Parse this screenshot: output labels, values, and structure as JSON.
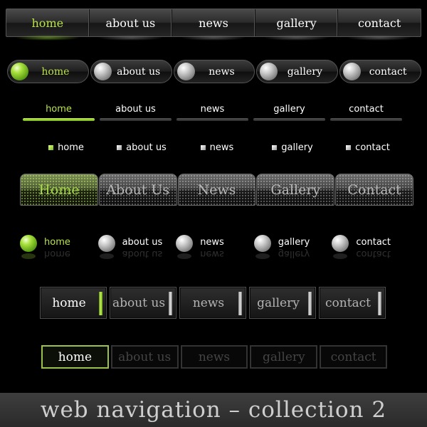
{
  "nav_labels": [
    "home",
    "about us",
    "news",
    "gallery",
    "contact"
  ],
  "nav_labels_capitalized": [
    "Home",
    "About Us",
    "News",
    "Gallery",
    "Contact"
  ],
  "active_item": "home",
  "colors": {
    "background": "#000000",
    "accent_green": "#b9e24a",
    "footer_band": "#3a3a3a",
    "footer_text": "#cfcfcf"
  },
  "icons": {
    "pill_button": "sphere-icon",
    "small_bullet": "square-bullet-icon",
    "ball_bullet": "sphere-icon",
    "side_indicator": "indicator-bar-icon"
  },
  "footer": {
    "caption": "web navigation – collection 2"
  }
}
